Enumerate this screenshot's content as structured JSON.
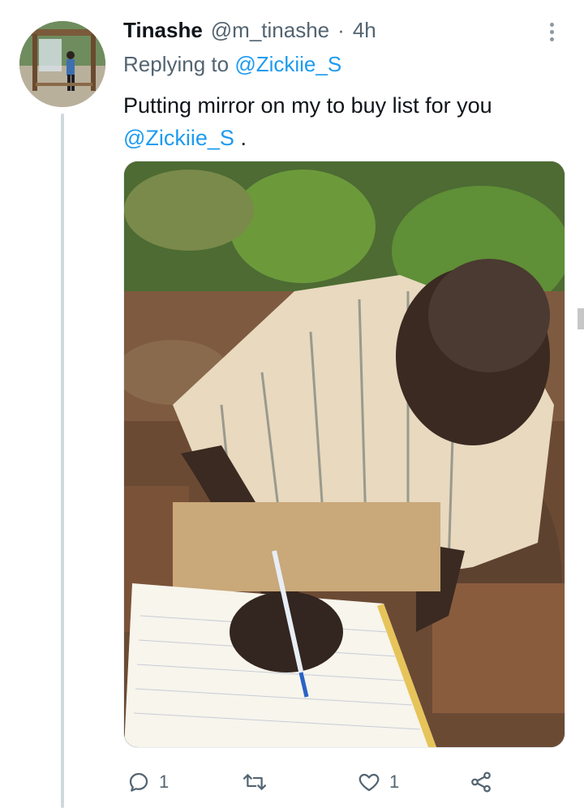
{
  "tweet": {
    "author_name": "Tinashe",
    "author_handle": "@m_tinashe",
    "separator": "·",
    "time": "4h",
    "replying_prefix": "Replying to",
    "replying_to": "@Zickiie_S",
    "text_main": "Putting mirror on my to buy list for you",
    "text_mention": "@Zickiie_S",
    "text_end": "."
  },
  "actions": {
    "reply_count": "1",
    "retweet_count": "",
    "like_count": "1"
  },
  "icons": {
    "more": "more-vertical-icon",
    "reply": "reply-icon",
    "retweet": "retweet-icon",
    "like": "heart-icon",
    "share": "share-icon"
  },
  "colors": {
    "link": "#1d9bf0",
    "secondary_text": "#536471",
    "thread_line": "#cfd9de"
  }
}
